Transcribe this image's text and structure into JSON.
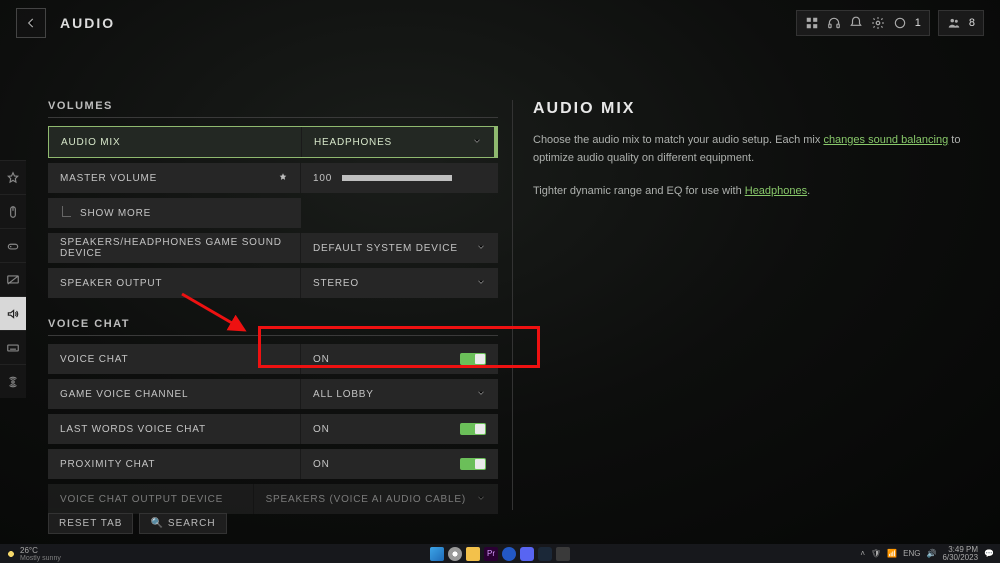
{
  "header": {
    "title": "AUDIO"
  },
  "topRight": {
    "notifCount": "1",
    "partyCount": "8"
  },
  "sections": {
    "volumes": {
      "title": "VOLUMES"
    },
    "voiceChat": {
      "title": "VOICE CHAT"
    }
  },
  "rows": {
    "audioMix": {
      "label": "AUDIO MIX",
      "value": "HEADPHONES"
    },
    "masterVolume": {
      "label": "MASTER VOLUME",
      "value": "100"
    },
    "showMore": {
      "label": "SHOW MORE"
    },
    "gameSoundDevice": {
      "label": "SPEAKERS/HEADPHONES GAME SOUND DEVICE",
      "value": "DEFAULT SYSTEM DEVICE"
    },
    "speakerOutput": {
      "label": "SPEAKER OUTPUT",
      "value": "STEREO"
    },
    "voiceChat": {
      "label": "VOICE CHAT",
      "value": "ON"
    },
    "gameVoiceChannel": {
      "label": "GAME VOICE CHANNEL",
      "value": "ALL LOBBY"
    },
    "lastWords": {
      "label": "LAST WORDS VOICE CHAT",
      "value": "ON"
    },
    "proximity": {
      "label": "PROXIMITY CHAT",
      "value": "ON"
    },
    "voiceOutput": {
      "label": "VOICE CHAT OUTPUT DEVICE",
      "value": "SPEAKERS (VOICE AI AUDIO CABLE)"
    }
  },
  "info": {
    "title": "AUDIO MIX",
    "line1a": "Choose the audio mix to match your audio setup. Each mix ",
    "line1link": "changes sound balancing",
    "line1b": " to optimize audio quality on different equipment.",
    "line2a": "Tighter dynamic range and EQ for use with ",
    "line2link": "Headphones",
    "line2b": "."
  },
  "buttons": {
    "reset": "RESET TAB",
    "search": "SEARCH"
  },
  "taskbar": {
    "temp": "26°C",
    "cond": "Mostly sunny",
    "lang": "ENG",
    "time": "3:49 PM",
    "date": "6/30/2023"
  }
}
